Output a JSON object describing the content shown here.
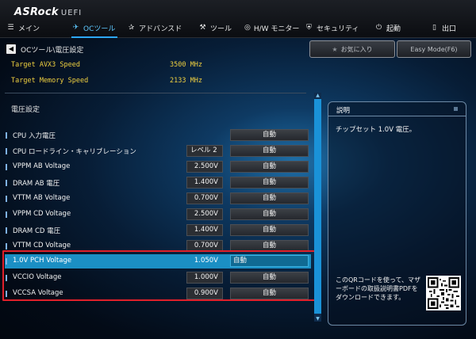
{
  "brand": {
    "name": "ASRock",
    "sub": "UEFI"
  },
  "nav": [
    {
      "icon": "☰",
      "icon_name": "list-icon",
      "label": "メイン",
      "active": false
    },
    {
      "icon": "✈",
      "icon_name": "rocket-icon",
      "label": "OCツール",
      "active": true
    },
    {
      "icon": "✰",
      "icon_name": "star-icon",
      "label": "アドバンスド",
      "active": false
    },
    {
      "icon": "⚒",
      "icon_name": "tools-icon",
      "label": "ツール",
      "active": false
    },
    {
      "icon": "◎",
      "icon_name": "monitor-icon",
      "label": "H/W モニター",
      "active": false
    },
    {
      "icon": "⛨",
      "icon_name": "shield-icon",
      "label": "セキュリティ",
      "active": false
    },
    {
      "icon": "⏻",
      "icon_name": "power-icon",
      "label": "起動",
      "active": false
    },
    {
      "icon": "▯",
      "icon_name": "exit-icon",
      "label": "出口",
      "active": false
    }
  ],
  "breadcrumb": "OCツール\\電圧設定",
  "buttons": {
    "favorite": "お気に入り",
    "easy_mode": "Easy Mode(F6)"
  },
  "info": [
    {
      "label": "Target AVX3 Speed",
      "value": "3500 MHz"
    },
    {
      "label": "Target Memory Speed",
      "value": "2133 MHz"
    }
  ],
  "section_title": "電圧設定",
  "rows": [
    {
      "label": "CPU 入力電圧",
      "value": "",
      "option": "自動",
      "highlight": false
    },
    {
      "label": "CPU ロードライン・キャリブレーション",
      "value": "レベル 2",
      "option": "自動",
      "highlight": false
    },
    {
      "label": "VPPM AB  Voltage",
      "value": "2.500V",
      "option": "自動",
      "highlight": false
    },
    {
      "label": "DRAM AB 電圧",
      "value": "1.400V",
      "option": "自動",
      "highlight": false
    },
    {
      "label": "VTTM AB  Voltage",
      "value": "0.700V",
      "option": "自動",
      "highlight": false
    },
    {
      "label": "VPPM CD  Voltage",
      "value": "2.500V",
      "option": "自動",
      "highlight": false
    },
    {
      "label": "DRAM CD 電圧",
      "value": "1.400V",
      "option": "自動",
      "highlight": false
    },
    {
      "label": "VTTM CD  Voltage",
      "value": "0.700V",
      "option": "自動",
      "highlight": false
    },
    {
      "label": "1.0V PCH Voltage",
      "value": "1.050V",
      "option": "自動",
      "highlight": true
    },
    {
      "label": "VCCIO     Voltage",
      "value": "1.000V",
      "option": "自動",
      "highlight": false
    },
    {
      "label": "VCCSA     Voltage",
      "value": "0.900V",
      "option": "自動",
      "highlight": false
    }
  ],
  "description": {
    "title": "説明",
    "text": "チップセット 1.0V 電圧。",
    "qr_text": "このQRコードを使って、マザーボードの取扱説明書PDFをダウンロードできます。"
  }
}
